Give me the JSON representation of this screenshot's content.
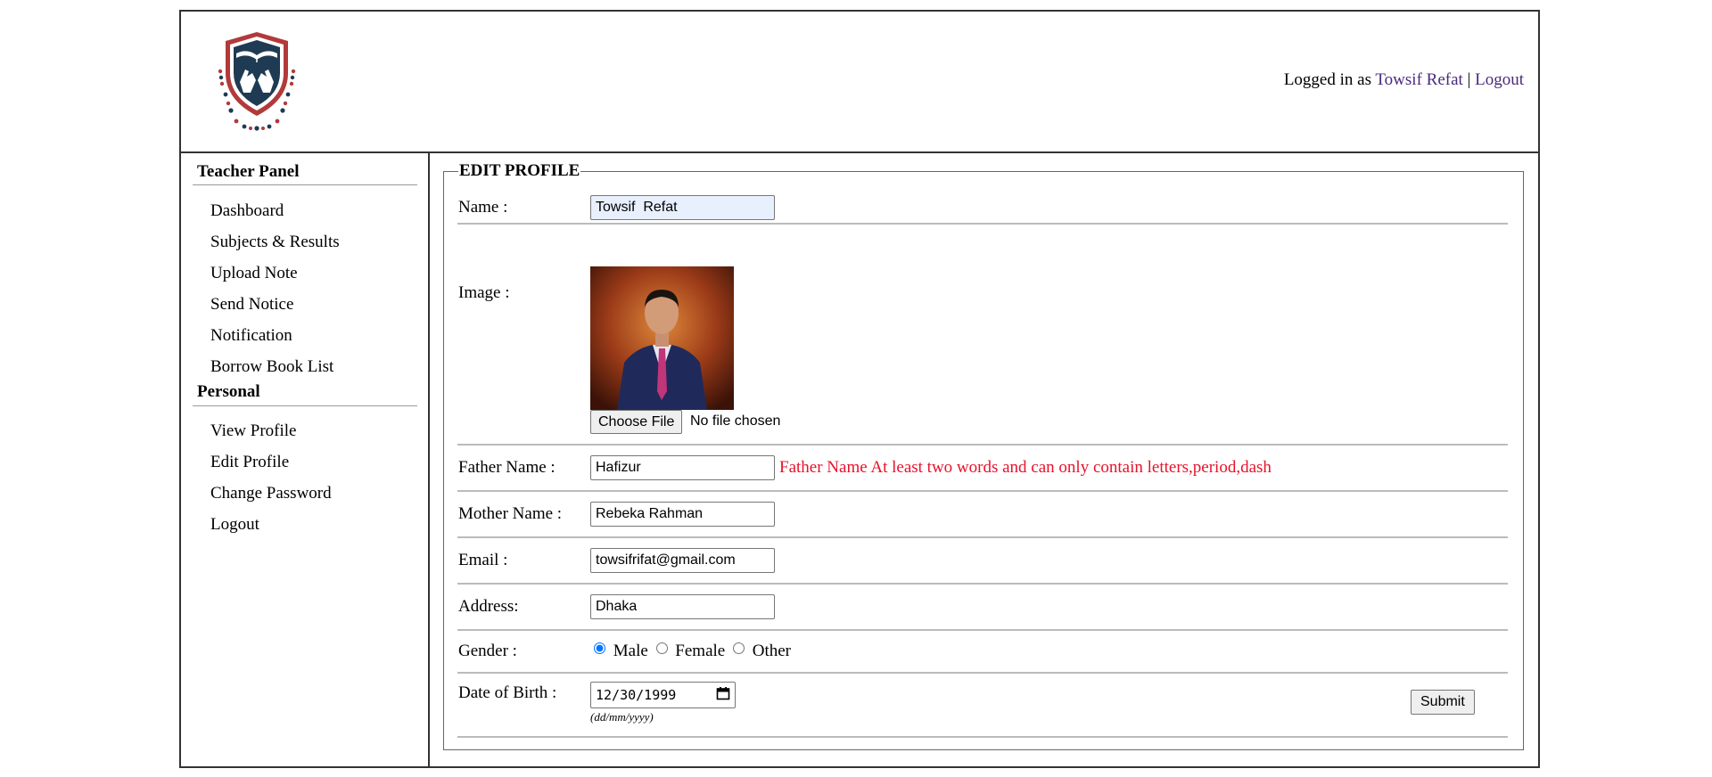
{
  "header": {
    "logged_in_prefix": "Logged in as",
    "user_name": "Towsif Refat",
    "separator": "|",
    "logout_label": "Logout",
    "logo_icon": "school-shield-book-logo"
  },
  "sidebar": {
    "panel_heading": "Teacher Panel",
    "panel_items": [
      "Dashboard",
      "Subjects & Results",
      "Upload Note",
      "Send Notice",
      "Notification",
      "Borrow Book List"
    ],
    "personal_heading": "Personal",
    "personal_items": [
      "View Profile",
      "Edit Profile",
      "Change Password",
      "Logout"
    ]
  },
  "form": {
    "legend": "EDIT PROFILE",
    "name_label": "Name :",
    "name_value": "Towsif  Refat",
    "image_label": "Image :",
    "choose_file_label": "Choose File",
    "file_status": "No file chosen",
    "father_label": "Father Name :",
    "father_value": "Hafizur",
    "father_error": "Father Name At least two words and can only contain letters,period,dash",
    "mother_label": "Mother Name :",
    "mother_value": "Rebeka Rahman",
    "email_label": "Email :",
    "email_value": "towsifrifat@gmail.com",
    "address_label": "Address:",
    "address_value": "Dhaka",
    "gender_label": "Gender :",
    "gender_options": [
      "Male",
      "Female",
      "Other"
    ],
    "gender_selected": "Male",
    "dob_label": "Date of Birth :",
    "dob_value": "12/30/1999",
    "dob_hint": "(dd/mm/yyyy)",
    "submit_label": "Submit"
  },
  "colors": {
    "link": "#4b2a7b",
    "error": "#e8122a",
    "autofill_bg": "#e8f0fe",
    "border": "#333333"
  }
}
